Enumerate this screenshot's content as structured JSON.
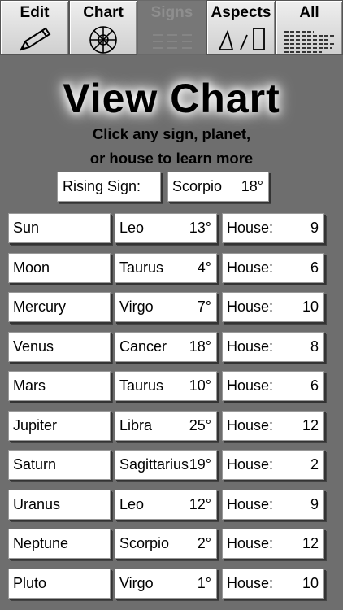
{
  "toolbar": {
    "buttons": [
      {
        "label": "Edit",
        "icon": "pencil-icon",
        "enabled": true
      },
      {
        "label": "Chart",
        "icon": "chart-wheel-icon",
        "enabled": true
      },
      {
        "label": "Signs",
        "icon": "signs-icon",
        "enabled": false
      },
      {
        "label": "Aspects",
        "icon": "aspects-icon",
        "enabled": true
      },
      {
        "label": "All",
        "icon": "list-icon",
        "enabled": true
      }
    ]
  },
  "header": {
    "title": "View Chart",
    "subtitle_line1": "Click any sign, planet,",
    "subtitle_line2": "or house to learn more"
  },
  "rising": {
    "label": "Rising Sign:",
    "sign": "Scorpio",
    "degree": "18°"
  },
  "planets": [
    {
      "planet": "Sun",
      "sign": "Leo",
      "degree": "13°",
      "house_label": "House:",
      "house": "9"
    },
    {
      "planet": "Moon",
      "sign": "Taurus",
      "degree": "4°",
      "house_label": "House:",
      "house": "6"
    },
    {
      "planet": "Mercury",
      "sign": "Virgo",
      "degree": "7°",
      "house_label": "House:",
      "house": "10"
    },
    {
      "planet": "Venus",
      "sign": "Cancer",
      "degree": "18°",
      "house_label": "House:",
      "house": "8"
    },
    {
      "planet": "Mars",
      "sign": "Taurus",
      "degree": "10°",
      "house_label": "House:",
      "house": "6"
    },
    {
      "planet": "Jupiter",
      "sign": "Libra",
      "degree": "25°",
      "house_label": "House:",
      "house": "12"
    },
    {
      "planet": "Saturn",
      "sign": "Sagittarius",
      "degree": "19°",
      "house_label": "House:",
      "house": "2"
    },
    {
      "planet": "Uranus",
      "sign": "Leo",
      "degree": "12°",
      "house_label": "House:",
      "house": "9"
    },
    {
      "planet": "Neptune",
      "sign": "Scorpio",
      "degree": "2°",
      "house_label": "House:",
      "house": "12"
    },
    {
      "planet": "Pluto",
      "sign": "Virgo",
      "degree": "1°",
      "house_label": "House:",
      "house": "10"
    }
  ]
}
